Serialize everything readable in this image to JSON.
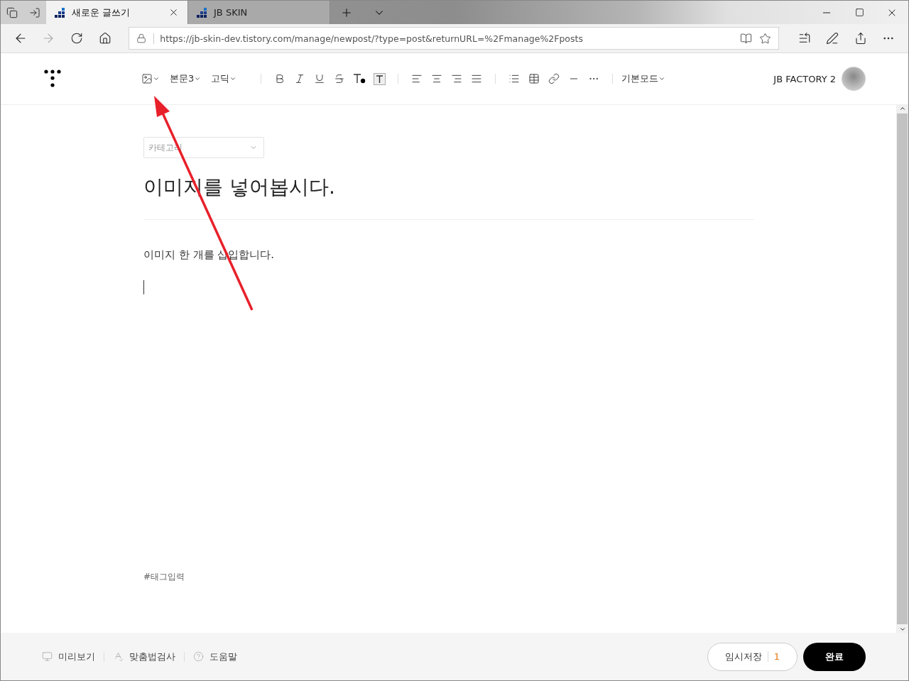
{
  "browser": {
    "tabs": [
      {
        "title": "새로운 글쓰기",
        "selected": true
      },
      {
        "title": "JB SKIN",
        "selected": false
      }
    ],
    "url": "https://jb-skin-dev.tistory.com/manage/newpost/?type=post&returnURL=%2Fmanage%2Fposts"
  },
  "toolbar": {
    "paragraph_style": "본문3",
    "font": "고딕",
    "mode": "기본모드",
    "user": "JB FACTORY 2"
  },
  "editor": {
    "category_placeholder": "카테고리",
    "title": "이미지를 넣어봅시다.",
    "body": "이미지 한 개를 삽입합니다.",
    "tag_placeholder": "#태그입력"
  },
  "footer": {
    "links": [
      "미리보기",
      "맞춤법검사",
      "도움말"
    ],
    "save_label": "임시저장",
    "save_count": "1",
    "done_label": "완료"
  }
}
